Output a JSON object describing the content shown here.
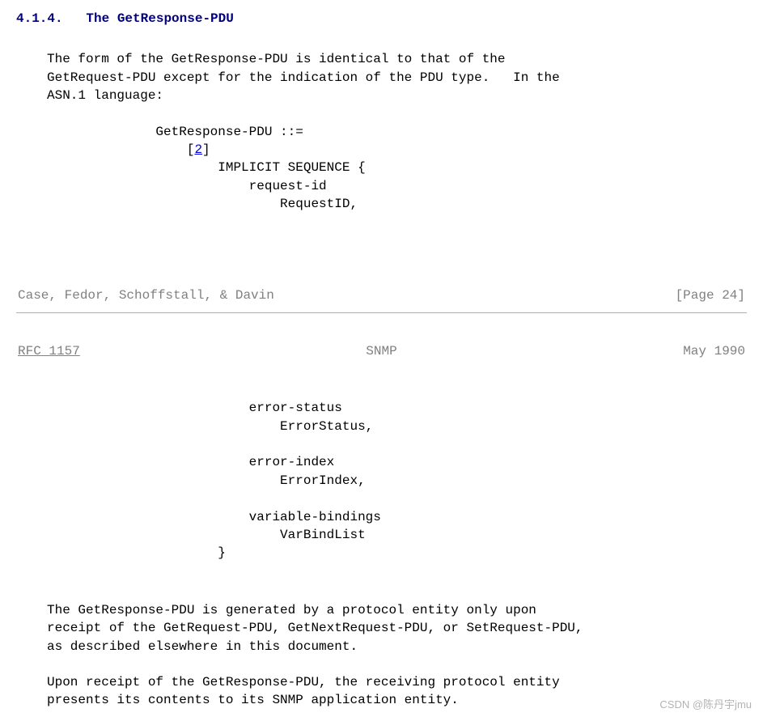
{
  "heading": {
    "number": "4.1.4.",
    "title": "The GetResponse-PDU"
  },
  "intro": "The form of the GetResponse-PDU is identical to that of the\nGetRequest-PDU except for the indication of the PDU type.   In the\nASN.1 language:",
  "asn1_top": {
    "line1": "              GetResponse-PDU ::=",
    "line2_pre": "                  [",
    "link": "2",
    "line2_post": "]",
    "line3": "                      IMPLICIT SEQUENCE {",
    "line4": "                          request-id",
    "line5": "                              RequestID,"
  },
  "footer": {
    "authors": "Case, Fedor, Schoffstall, & Davin",
    "page": "[Page 24]"
  },
  "header": {
    "rfc": "RFC 1157",
    "title": "SNMP",
    "date": "May 1990"
  },
  "asn1_bottom": "                          error-status\n                              ErrorStatus,\n\n                          error-index\n                              ErrorIndex,\n\n                          variable-bindings\n                              VarBindList\n                      }",
  "para2": "The GetResponse-PDU is generated by a protocol entity only upon\nreceipt of the GetRequest-PDU, GetNextRequest-PDU, or SetRequest-PDU,\nas described elsewhere in this document.",
  "para3": "Upon receipt of the GetResponse-PDU, the receiving protocol entity\npresents its contents to its SNMP application entity.",
  "watermark": "CSDN @陈丹宇jmu"
}
